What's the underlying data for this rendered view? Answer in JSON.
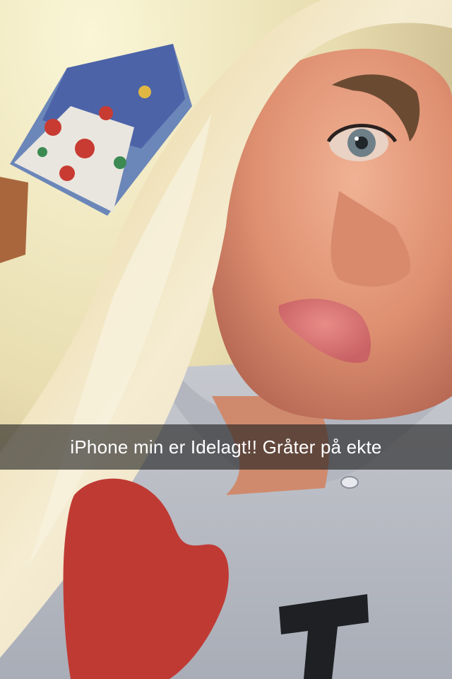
{
  "snap": {
    "caption": "iPhone min er Idelagt!! Gråter på ekte"
  },
  "colors": {
    "wall": "#eee3b4",
    "hair": "#f3e9c8",
    "skin": "#e8a07e",
    "hoodie": "#b9bcc4",
    "heart": "#c23a34",
    "caption_bar": "#1e1e1e"
  }
}
